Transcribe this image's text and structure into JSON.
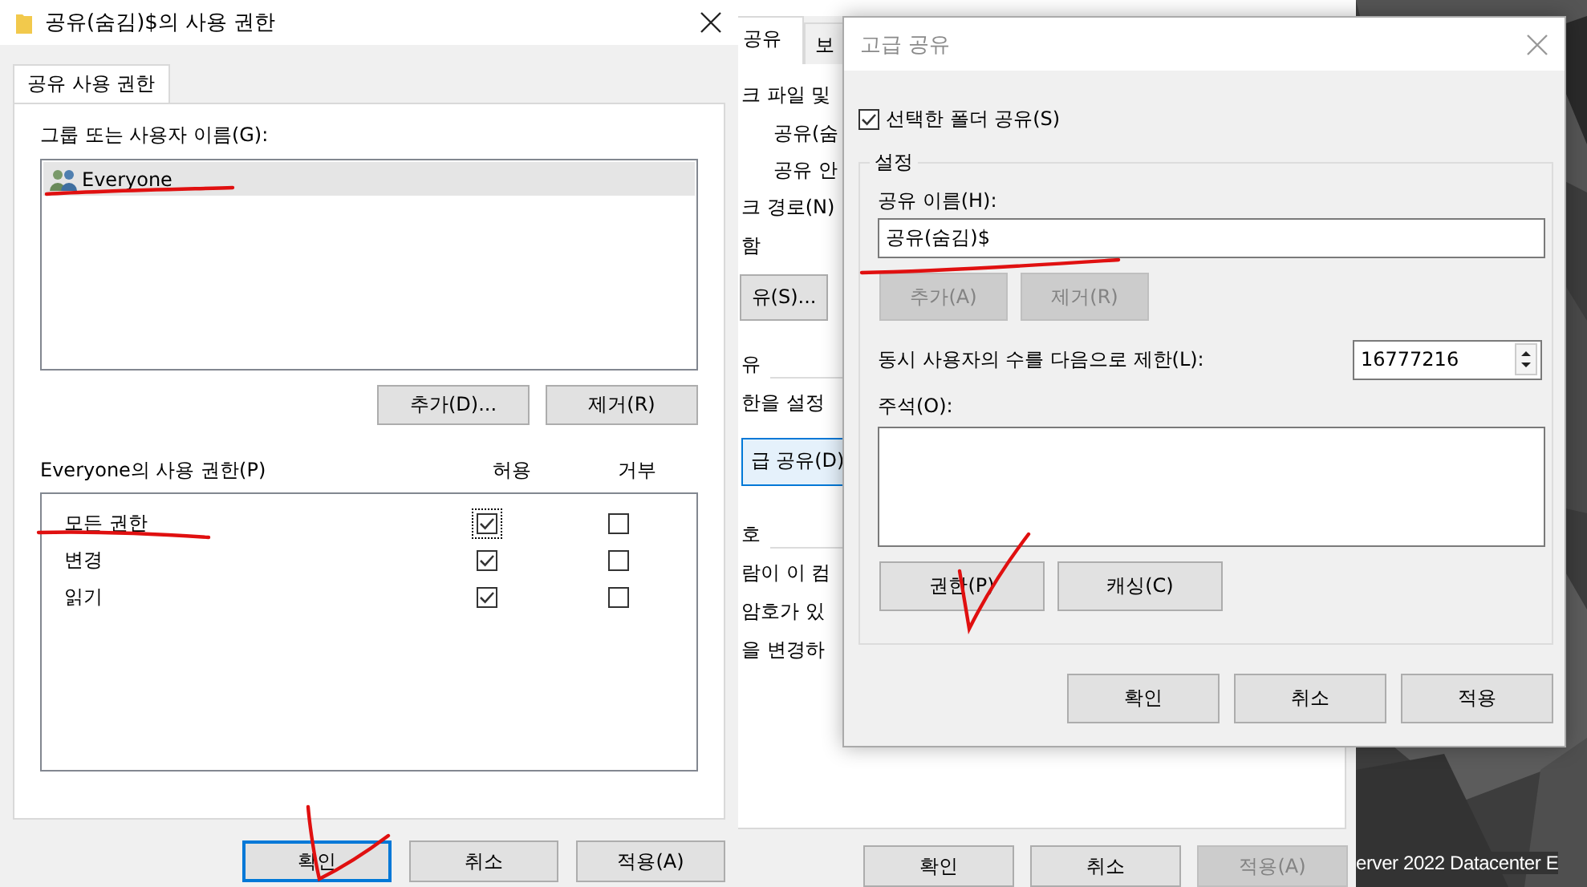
{
  "permissions_dialog": {
    "title": "공유(숨김)$의 사용 권한",
    "tabs": [
      {
        "label": "공유 사용 권한",
        "selected": true
      }
    ],
    "group_label": "그룹 또는 사용자 이름(G):",
    "principals": [
      {
        "name": "Everyone",
        "selected": true
      }
    ],
    "principal_buttons": [
      "추가(D)...",
      "제거(R)"
    ],
    "permissions_label": "Everyone의 사용 권한(P)",
    "allow_header": "허용",
    "deny_header": "거부",
    "permissions": [
      {
        "name": "모든 권한",
        "allow": true,
        "deny": false,
        "focused": true
      },
      {
        "name": "변경",
        "allow": true,
        "deny": false,
        "focused": false
      },
      {
        "name": "읽기",
        "allow": true,
        "deny": false,
        "focused": false
      }
    ],
    "buttons": [
      {
        "label": "확인",
        "default": true
      },
      {
        "label": "취소",
        "default": false
      },
      {
        "label": "적용(A)",
        "default": false
      }
    ]
  },
  "properties_window": {
    "tabs": [
      {
        "label": "공유",
        "selected": true
      },
      {
        "label": "보",
        "selected": false
      }
    ],
    "items": [
      {
        "kind": "text",
        "text": "크 파일 및"
      },
      {
        "kind": "indent",
        "text": "공유(숨"
      },
      {
        "kind": "indent",
        "text": "공유 안"
      },
      {
        "kind": "text",
        "text": "크 경로(N)"
      },
      {
        "kind": "text",
        "text": "함"
      },
      {
        "kind": "button",
        "text": "유(S)..."
      },
      {
        "kind": "section",
        "text": "유"
      },
      {
        "kind": "text",
        "text": "한을 설정"
      },
      {
        "kind": "focus-button",
        "text": "급 공유(D)"
      },
      {
        "kind": "section",
        "text": "호"
      },
      {
        "kind": "text",
        "text": "람이 이 컴"
      },
      {
        "kind": "text",
        "text": "암호가 있"
      },
      {
        "kind": "text",
        "text": "을 변경하"
      }
    ],
    "buttons": [
      {
        "label": "확인",
        "disabled": false
      },
      {
        "label": "취소",
        "disabled": false
      },
      {
        "label": "적용(A)",
        "disabled": true
      }
    ]
  },
  "advanced_sharing": {
    "title": "고급 공유",
    "active": false,
    "share_folder": {
      "label": "선택한 폴더 공유(S)",
      "checked": true
    },
    "group_title": "설정",
    "share_name_label": "공유 이름(H):",
    "share_name": "공유(숨김)$",
    "name_buttons": [
      {
        "label": "추가(A)",
        "disabled": true
      },
      {
        "label": "제거(R)",
        "disabled": true
      }
    ],
    "user_limit_label": "동시 사용자의 수를 다음으로 제한(L):",
    "user_limit": "16777216",
    "comment_label": "주석(O):",
    "group_buttons": [
      "권한(P)",
      "캐싱(C)"
    ],
    "buttons": [
      "확인",
      "취소",
      "적용"
    ]
  },
  "desktop": {
    "text": "erver 2022 Datacenter E"
  }
}
